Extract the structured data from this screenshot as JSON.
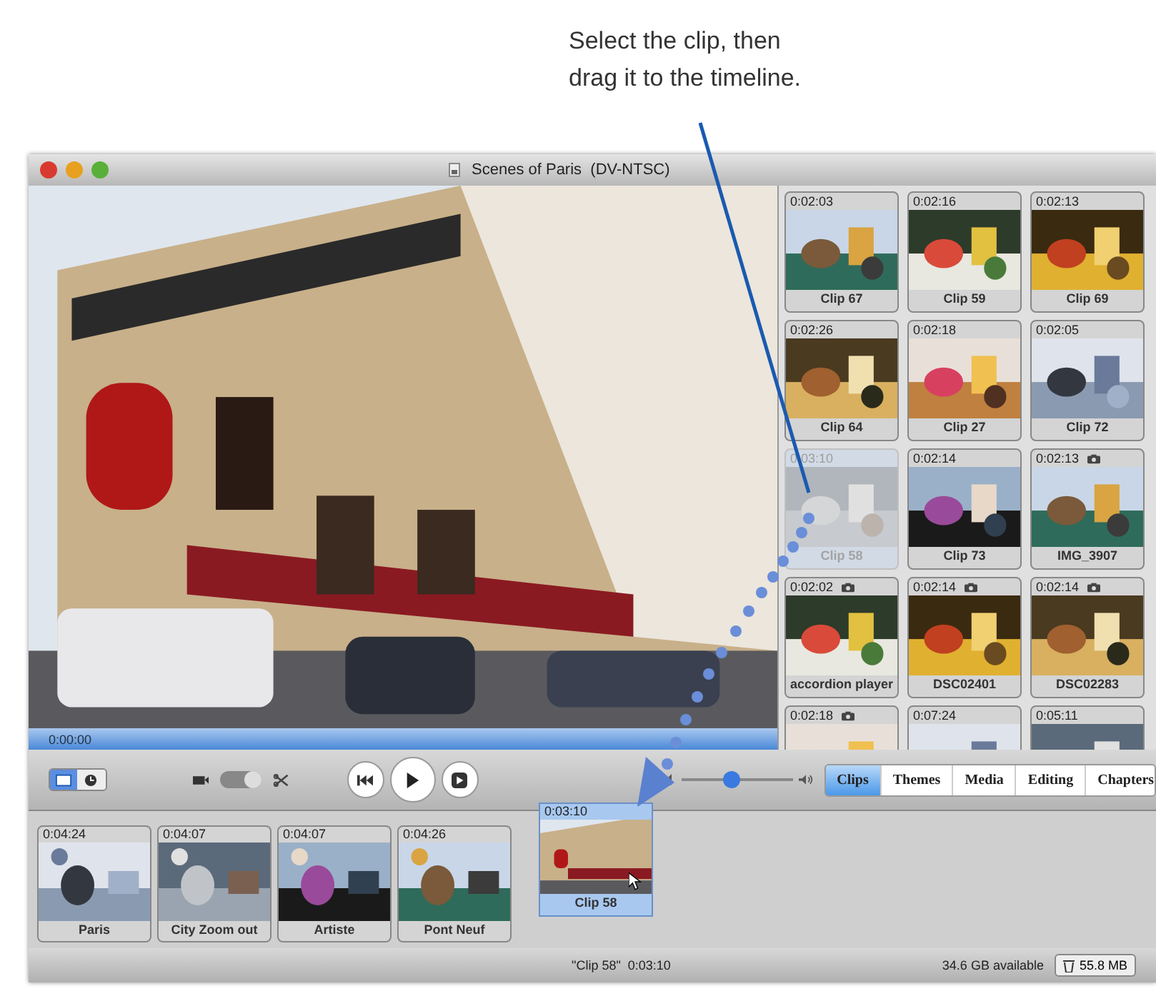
{
  "callout": "Select the clip, then\ndrag it to the timeline.",
  "window": {
    "title": "Scenes of Paris  (DV-NTSC)"
  },
  "viewer": {
    "timecode": "0:00:00"
  },
  "clips": [
    {
      "duration": "0:02:03",
      "name": "Clip 67",
      "camera": false,
      "selected": false
    },
    {
      "duration": "0:02:16",
      "name": "Clip 59",
      "camera": false,
      "selected": false
    },
    {
      "duration": "0:02:13",
      "name": "Clip 69",
      "camera": false,
      "selected": false
    },
    {
      "duration": "0:02:26",
      "name": "Clip 64",
      "camera": false,
      "selected": false
    },
    {
      "duration": "0:02:18",
      "name": "Clip 27",
      "camera": false,
      "selected": false
    },
    {
      "duration": "0:02:05",
      "name": "Clip 72",
      "camera": false,
      "selected": false
    },
    {
      "duration": "0:03:10",
      "name": "Clip 58",
      "camera": false,
      "selected": true
    },
    {
      "duration": "0:02:14",
      "name": "Clip 73",
      "camera": false,
      "selected": false
    },
    {
      "duration": "0:02:13",
      "name": "IMG_3907",
      "camera": true,
      "selected": false
    },
    {
      "duration": "0:02:02",
      "name": "accordion player",
      "camera": true,
      "selected": false
    },
    {
      "duration": "0:02:14",
      "name": "DSC02401",
      "camera": true,
      "selected": false
    },
    {
      "duration": "0:02:14",
      "name": "DSC02283",
      "camera": true,
      "selected": false
    },
    {
      "duration": "0:02:18",
      "camera": true,
      "selected": false
    },
    {
      "duration": "0:07:24",
      "camera": false,
      "selected": false
    },
    {
      "duration": "0:05:11",
      "camera": false,
      "selected": false
    }
  ],
  "mode_switch": {
    "on": true
  },
  "volume": {
    "level": 0.45
  },
  "tabs": [
    {
      "label": "Clips",
      "selected": true
    },
    {
      "label": "Themes",
      "selected": false
    },
    {
      "label": "Media",
      "selected": false
    },
    {
      "label": "Editing",
      "selected": false
    },
    {
      "label": "Chapters",
      "selected": false
    }
  ],
  "timeline": [
    {
      "duration": "0:04:24",
      "name": "Paris"
    },
    {
      "duration": "0:04:07",
      "name": "City Zoom out"
    },
    {
      "duration": "0:04:07",
      "name": "Artiste"
    },
    {
      "duration": "0:04:26",
      "name": "Pont Neuf"
    }
  ],
  "dragged_clip": {
    "duration": "0:03:10",
    "name": "Clip 58"
  },
  "status_bar": {
    "clip_info": "\"Clip 58\"  0:03:10",
    "disk_space": "34.6 GB available",
    "trash": "55.8 MB"
  }
}
